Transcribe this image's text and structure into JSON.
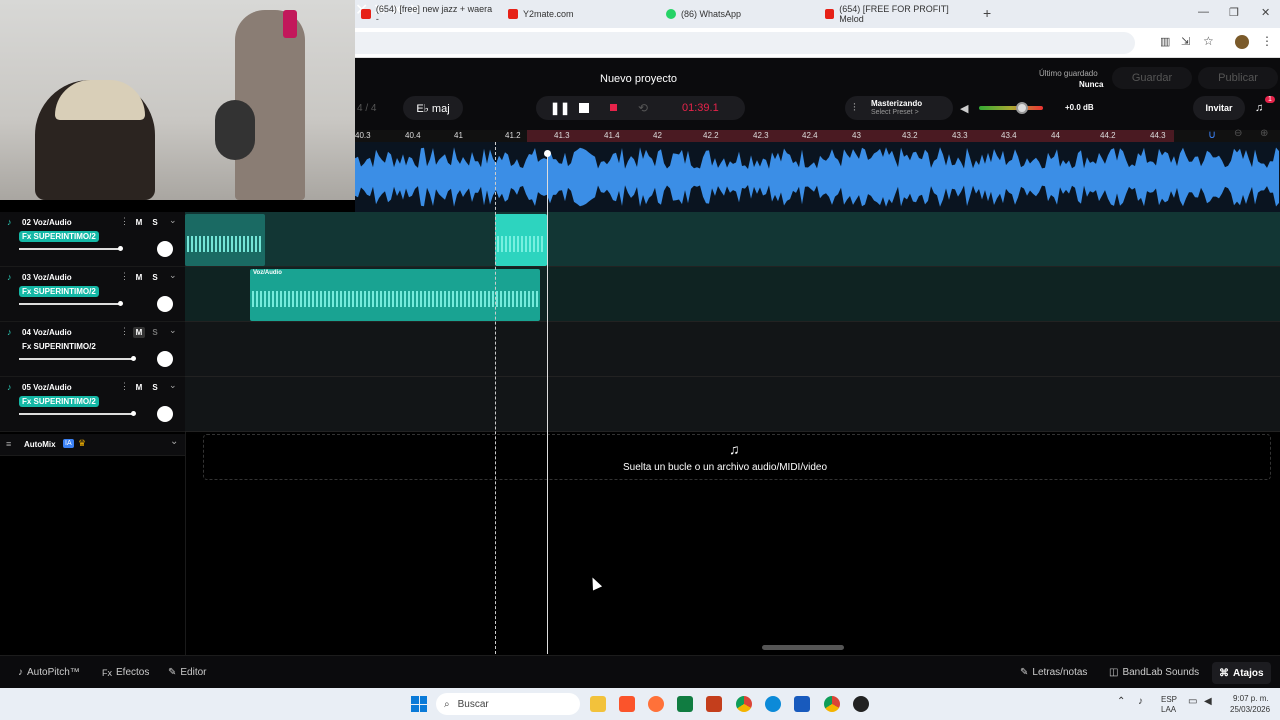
{
  "browser": {
    "tabs": [
      {
        "label": "(654) [free] new jazz + waera -",
        "color": "#e62117"
      },
      {
        "label": "Y2mate.com",
        "color": "#e62117"
      },
      {
        "label": "(86) WhatsApp",
        "color": "#25d366"
      },
      {
        "label": "(654) [FREE FOR PROFIT] Melod",
        "color": "#e62117"
      }
    ],
    "new_tab": "+",
    "win_min": "—",
    "win_max": "❐",
    "win_close": "✕"
  },
  "daw": {
    "project_title": "Nuevo proyecto",
    "time_sig": "4 / 4",
    "key": "E♭ maj",
    "time": "01:39.1",
    "mastering_label": "Masterizando",
    "mastering_preset": "Select Preset >",
    "volume_db": "+0.0 dB",
    "volume_level": 0.67,
    "last_saved_label": "Último guardado",
    "last_saved_value": "Nunca",
    "save": "Guardar",
    "publish": "Publicar",
    "invite": "Invitar",
    "notif_count": "1",
    "accent": "#e6234a"
  },
  "ruler": [
    "40.3",
    "40.4",
    "41",
    "41.2",
    "41.3",
    "41.4",
    "42",
    "42.2",
    "42.3",
    "42.4",
    "43",
    "43.2",
    "43.3",
    "43.4",
    "44",
    "44.2",
    "44.3"
  ],
  "tracks": [
    {
      "name": "02 Voz/Audio",
      "fx": "Fx SUPERINTIMO/2",
      "fx_active": true,
      "m": "M",
      "s": "S",
      "fader": 0.75
    },
    {
      "name": "03 Voz/Audio",
      "fx": "Fx SUPERINTIMO/2",
      "fx_active": true,
      "m": "M",
      "s": "S",
      "fader": 0.75
    },
    {
      "name": "04 Voz/Audio",
      "fx": "Fx SUPERINTIMO/2",
      "fx_active": false,
      "m": "M",
      "s": "S",
      "fader": 0.85
    },
    {
      "name": "05 Voz/Audio",
      "fx": "Fx SUPERINTIMO/2",
      "fx_active": true,
      "m": "M",
      "s": "S",
      "fader": 0.85
    }
  ],
  "clip_label": "Voz/Audio",
  "automix": {
    "label": "AutoMix",
    "badge": "IA",
    "chevron": "⌄"
  },
  "dropzone": "Suelta un bucle o un archivo audio/MIDI/video",
  "footer": {
    "autopitch": "AutoPitch™",
    "effects": "Efectos",
    "editor": "Editor",
    "lyrics": "Letras/notas",
    "sounds": "BandLab Sounds",
    "shortcuts": "Atajos"
  },
  "taskbar": {
    "search": "Buscar",
    "lang1": "ESP",
    "lang2": "LAA",
    "time": "9:07 p. m.",
    "date": "25/03/2026"
  }
}
